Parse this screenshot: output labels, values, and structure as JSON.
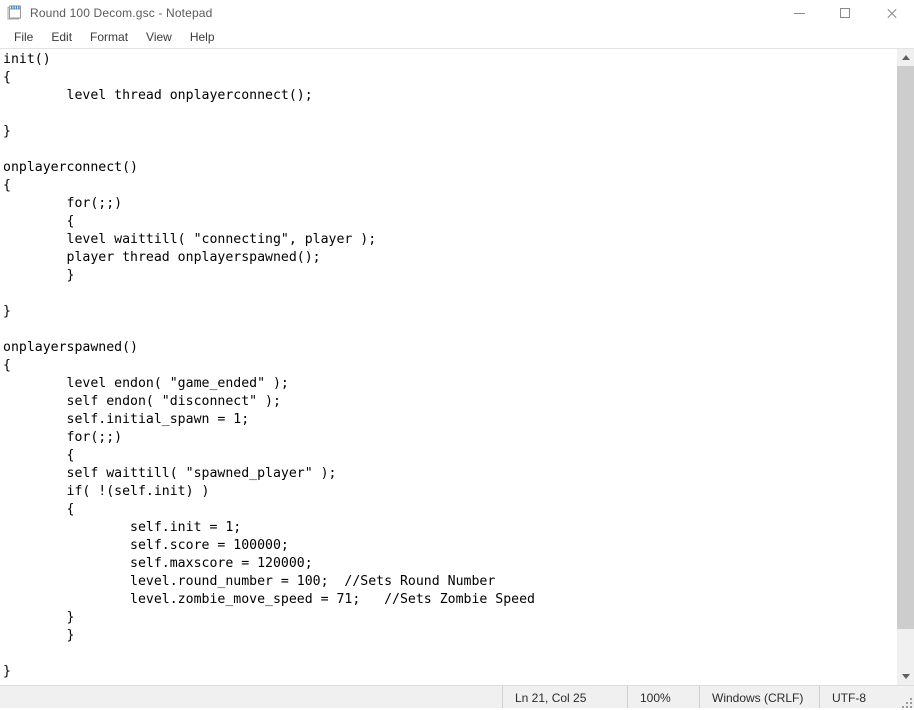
{
  "window": {
    "title": "Round 100 Decom.gsc - Notepad",
    "icon": "notepad-icon",
    "controls": {
      "minimize": "minimize-button",
      "maximize": "maximize-button",
      "close": "close-button"
    }
  },
  "menubar": {
    "items": [
      {
        "label": "File"
      },
      {
        "label": "Edit"
      },
      {
        "label": "Format"
      },
      {
        "label": "View"
      },
      {
        "label": "Help"
      }
    ]
  },
  "editor": {
    "content": "init()\n{\n\tlevel thread onplayerconnect();\n\n}\n\nonplayerconnect()\n{\n\tfor(;;)\n\t{\n\tlevel waittill( \"connecting\", player );\n\tplayer thread onplayerspawned();\n\t}\n\n}\n\nonplayerspawned()\n{\n\tlevel endon( \"game_ended\" );\n\tself endon( \"disconnect\" );\n\tself.initial_spawn = 1;\n\tfor(;;)\n\t{\n\tself waittill( \"spawned_player\" );\n\tif( !(self.init) )\n\t{\n\t\tself.init = 1;\n\t\tself.score = 100000;\n\t\tself.maxscore = 120000;\n\t\tlevel.round_number = 100;  //Sets Round Number\n\t\tlevel.zombie_move_speed = 71;   //Sets Zombie Speed\n\t}\n\t}\n\n}"
  },
  "scrollbar": {
    "up_arrow": "scroll-up-arrow",
    "down_arrow": "scroll-down-arrow"
  },
  "statusbar": {
    "cursor_position": "Ln 21, Col 25",
    "zoom_level": "100%",
    "line_ending": "Windows (CRLF)",
    "encoding": "UTF-8"
  }
}
